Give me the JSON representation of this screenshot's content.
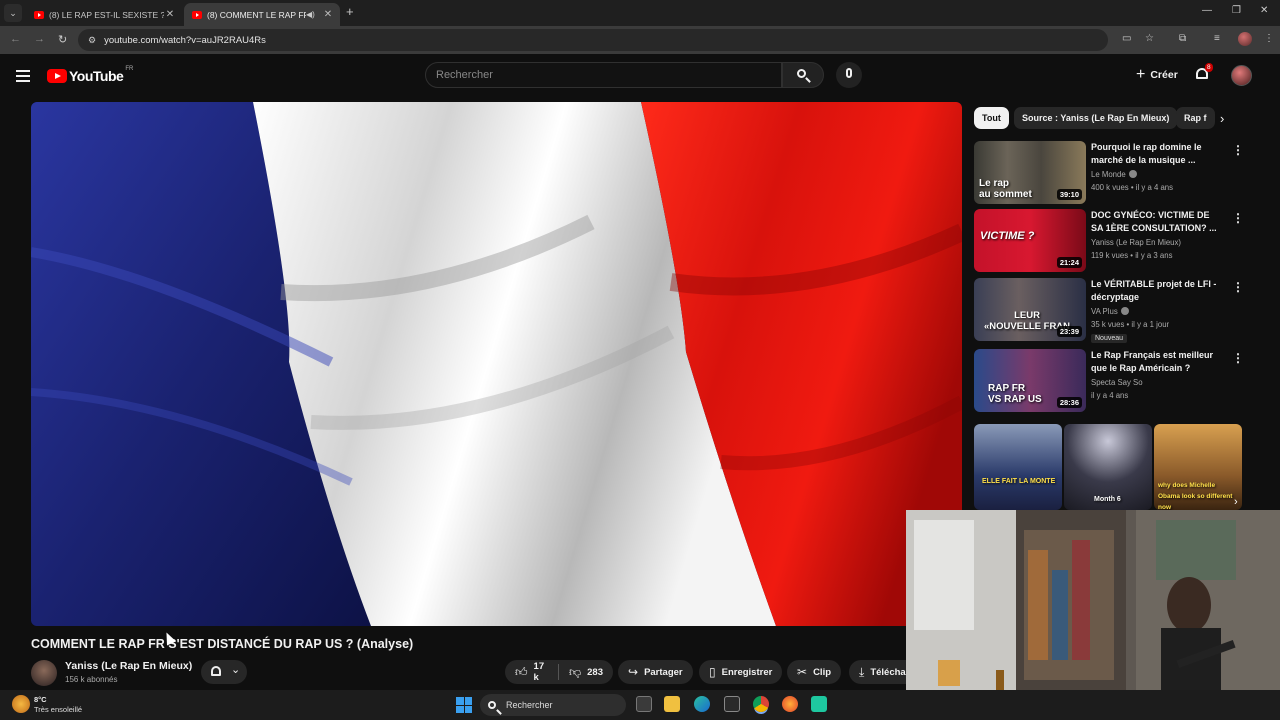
{
  "browser": {
    "tabs": [
      {
        "title": "(8) LE RAP EST-IL SEXISTE ? (4 P",
        "active": false
      },
      {
        "title": "(8) COMMENT LE RAP FR S'E",
        "active": true
      }
    ],
    "url": "youtube.com/watch?v=auJR2RAU4Rs"
  },
  "header": {
    "logo_text": "YouTube",
    "country_code": "FR",
    "search_placeholder": "Rechercher",
    "create_label": "Créer",
    "notification_count": "8"
  },
  "video": {
    "title": "COMMENT LE RAP FR S'EST DISTANCÉ DU RAP US ? (Analyse)",
    "channel": "Yaniss (Le Rap En Mieux)",
    "subscribers": "156 k abonnés",
    "likes": "17 k",
    "dislikes": "283",
    "share_label": "Partager",
    "save_label": "Enregistrer",
    "clip_label": "Clip",
    "download_label": "Télécha"
  },
  "sidebar": {
    "chips": [
      "Tout",
      "Source : Yaniss (Le Rap En Mieux)",
      "Rap f"
    ],
    "recommendations": [
      {
        "title": "Pourquoi le rap domine le marché de la musique ...",
        "channel": "Le Monde",
        "verified": true,
        "meta": "400 k vues • il y a 4 ans",
        "duration": "39:10",
        "thumb_text": "Le rap\nau sommet",
        "badge": ""
      },
      {
        "title": "DOC GYNÉCO: VICTIME DE SA 1ÈRE CONSULTATION? ...",
        "channel": "Yaniss (Le Rap En Mieux)",
        "verified": false,
        "meta": "119 k vues • il y a 3 ans",
        "duration": "21:24",
        "thumb_text": "VICTIME ?",
        "badge": ""
      },
      {
        "title": "Le VÉRITABLE projet de LFI - décryptage",
        "channel": "VA Plus",
        "verified": true,
        "meta": "35 k vues • il y a 1 jour",
        "duration": "23:39",
        "thumb_text": "LEUR\n«NOUVELLE FRAN",
        "badge": "Nouveau"
      },
      {
        "title": "Le Rap Français est meilleur que le Rap Américain ?",
        "channel": "Specta Say So",
        "verified": false,
        "meta": "il y a 4 ans",
        "duration": "28:36",
        "thumb_text": "RAP FR\nVS RAP US",
        "badge": ""
      }
    ],
    "shorts": [
      {
        "caption": "ELLE FAIT LA MONTE"
      },
      {
        "caption": "Month 6"
      },
      {
        "caption": "why does Michelle Obama look so different now"
      }
    ]
  },
  "taskbar": {
    "weather_temp": "8°C",
    "weather_desc": "Très ensoleillé",
    "search_label": "Rechercher"
  },
  "colors": {
    "accent": "#ff0000",
    "background": "#0f0f0f",
    "flag_blue": "#1e2a8c",
    "flag_red": "#e0140f"
  }
}
